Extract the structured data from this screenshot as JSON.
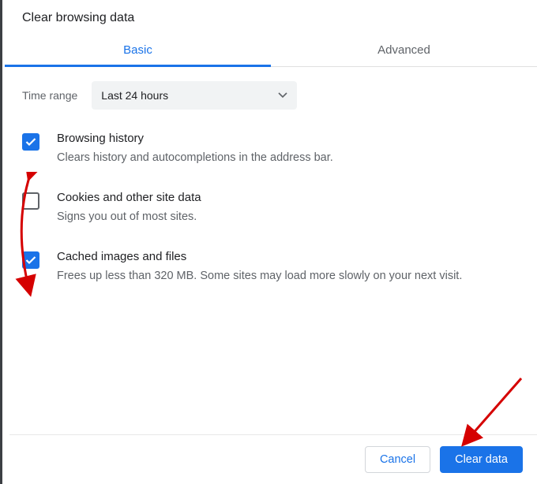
{
  "title": "Clear browsing data",
  "tabs": {
    "basic": "Basic",
    "advanced": "Advanced"
  },
  "time_range": {
    "label": "Time range",
    "selected": "Last 24 hours"
  },
  "items": [
    {
      "title": "Browsing history",
      "desc": "Clears history and autocompletions in the address bar.",
      "checked": true
    },
    {
      "title": "Cookies and other site data",
      "desc": "Signs you out of most sites.",
      "checked": false
    },
    {
      "title": "Cached images and files",
      "desc": "Frees up less than 320 MB. Some sites may load more slowly on your next visit.",
      "checked": true
    }
  ],
  "buttons": {
    "cancel": "Cancel",
    "clear": "Clear data"
  },
  "colors": {
    "accent": "#1a73e8",
    "annotation": "#d50000"
  }
}
